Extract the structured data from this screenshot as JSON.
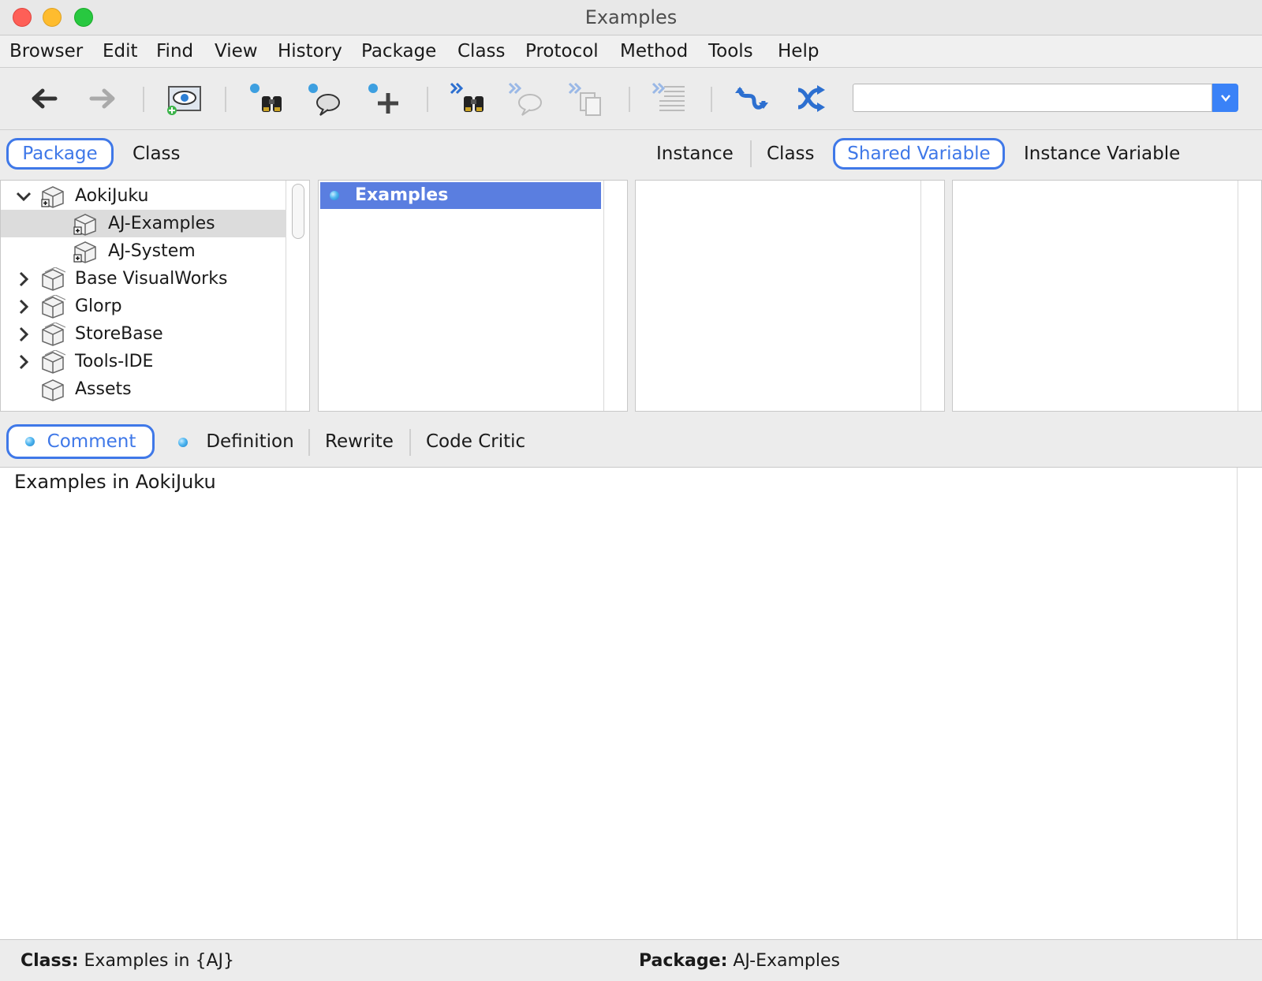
{
  "window": {
    "title": "Examples"
  },
  "menubar": {
    "items": [
      "Browser",
      "Edit",
      "Find",
      "View",
      "History",
      "Package",
      "Class",
      "Protocol",
      "Method",
      "Tools",
      "Help"
    ]
  },
  "toolbar": {
    "buttons": [
      {
        "icon": "back-arrow-icon"
      },
      {
        "icon": "forward-arrow-icon",
        "enabled": false
      },
      {
        "icon": "visibility-eye-icon"
      },
      {
        "icon": "find-binoculars-icon"
      },
      {
        "icon": "find-references-icon"
      },
      {
        "icon": "add-icon"
      },
      {
        "icon": "find-next-binoculars-icon"
      },
      {
        "icon": "next-reference-icon",
        "enabled": false
      },
      {
        "icon": "next-copy-icon",
        "enabled": false
      },
      {
        "icon": "format-text-icon",
        "enabled": false
      },
      {
        "icon": "refresh-icon"
      },
      {
        "icon": "shuffle-icon"
      }
    ],
    "search": {
      "value": "",
      "placeholder": ""
    }
  },
  "view_tabs": {
    "left": [
      "Package",
      "Class"
    ],
    "left_selected": "Package",
    "right": [
      "Instance",
      "Class",
      "Shared Variable",
      "Instance Variable"
    ],
    "right_selected": "Shared Variable"
  },
  "package_tree": [
    {
      "label": "AokiJuku",
      "expanded": true,
      "level": 0
    },
    {
      "label": "AJ-Examples",
      "level": 1,
      "selected": true
    },
    {
      "label": "AJ-System",
      "level": 1
    },
    {
      "label": "Base VisualWorks",
      "expanded": false,
      "level": 0
    },
    {
      "label": "Glorp",
      "expanded": false,
      "level": 0
    },
    {
      "label": "StoreBase",
      "expanded": false,
      "level": 0
    },
    {
      "label": "Tools-IDE",
      "expanded": false,
      "level": 0
    },
    {
      "label": "Assets",
      "level": 0
    }
  ],
  "class_list": {
    "items": [
      {
        "label": "Examples",
        "selected": true
      }
    ]
  },
  "code_tabs": {
    "items": [
      "Comment",
      "Definition",
      "Rewrite",
      "Code Critic"
    ],
    "selected": "Comment"
  },
  "editor": {
    "text": "Examples in AokiJuku"
  },
  "status_bar": {
    "class_label": "Class:",
    "class_value": "Examples in {AJ}",
    "package_label": "Package:",
    "package_value": "AJ-Examples"
  },
  "colors": {
    "accent": "#3f78e8",
    "selection": "#5a7ee0",
    "tree_selection": "#dcdcdc"
  }
}
